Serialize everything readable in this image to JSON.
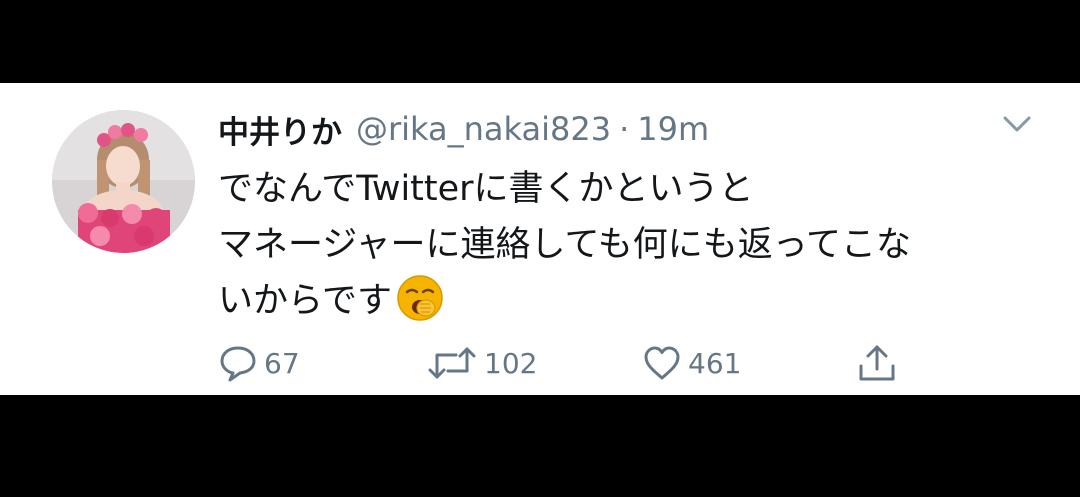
{
  "tweet": {
    "display_name": "中井りか",
    "handle": "@rika_nakai823",
    "separator": "·",
    "time": "19m",
    "text_lines": [
      "でなんでTwitterに書くかというと",
      "マネージャーに連絡しても何にも返ってこな",
      "いからです"
    ],
    "emoji": "yawning-face-emoji"
  },
  "actions": {
    "reply_count": "67",
    "retweet_count": "102",
    "like_count": "461"
  },
  "colors": {
    "background": "#000000",
    "card": "#ffffff",
    "text": "#14171a",
    "muted": "#657786",
    "emoji": "#f6b400"
  },
  "icons": {
    "avatar": "profile-photo",
    "more": "chevron-down-icon",
    "reply": "reply-icon",
    "retweet": "retweet-icon",
    "like": "heart-icon",
    "share": "share-icon"
  }
}
